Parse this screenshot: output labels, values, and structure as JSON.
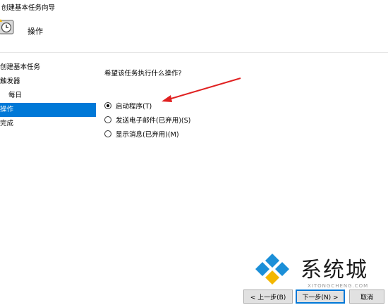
{
  "window": {
    "title": "创建基本任务向导"
  },
  "header": {
    "heading": "操作"
  },
  "nav": {
    "items": [
      {
        "label": "创建基本任务",
        "sub": false,
        "active": false
      },
      {
        "label": "触发器",
        "sub": false,
        "active": false
      },
      {
        "label": "每日",
        "sub": true,
        "active": false
      },
      {
        "label": "操作",
        "sub": false,
        "active": true
      },
      {
        "label": "完成",
        "sub": false,
        "active": false
      }
    ]
  },
  "main": {
    "question": "希望该任务执行什么操作?",
    "options": [
      {
        "label": "启动程序(T)",
        "checked": true
      },
      {
        "label": "发送电子邮件(已弃用)(S)",
        "checked": false
      },
      {
        "label": "显示消息(已弃用)(M)",
        "checked": false
      }
    ]
  },
  "buttons": {
    "back": "< 上一步(B)",
    "next": "下一步(N) >",
    "cancel": "取消"
  },
  "watermark": {
    "text": "系统城",
    "sub": "XITONGCHENG.COM"
  },
  "colors": {
    "accent": "#0078d7",
    "arrow": "#e02020"
  },
  "icons": [
    "task-clock-icon",
    "radio-icon",
    "red-arrow-annotation",
    "watermark-logo-icon"
  ]
}
